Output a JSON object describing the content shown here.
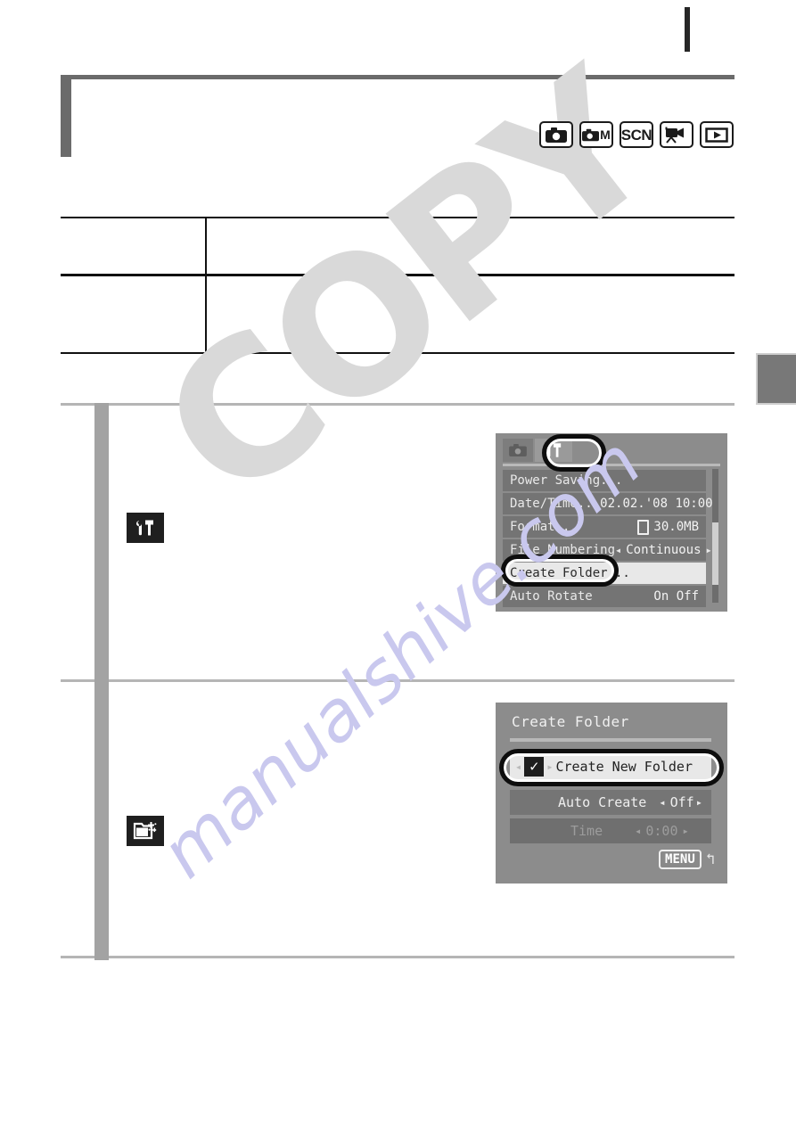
{
  "page": {
    "header": {
      "title": ""
    },
    "edge_tab_label": ""
  },
  "mode_icons": [
    {
      "name": "still-image-mode",
      "glyph": "camera"
    },
    {
      "name": "manual-mode",
      "glyph": "camera-m",
      "letter": "M"
    },
    {
      "name": "scene-mode",
      "glyph": "SCN"
    },
    {
      "name": "movie-mode",
      "glyph": "movie-camera"
    },
    {
      "name": "playback-mode",
      "glyph": "play"
    }
  ],
  "table": {
    "rows": [
      {
        "left": "",
        "right": ""
      },
      {
        "left": "",
        "right": ""
      }
    ]
  },
  "steps": [
    {
      "icon": "settings-tools-icon",
      "body": ""
    },
    {
      "icon": "create-folder-icon",
      "body": ""
    }
  ],
  "lcd_settings_menu": {
    "tabs": [
      {
        "name": "shooting-tab",
        "glyph": "camera"
      },
      {
        "name": "settings-tab",
        "glyph": "tools",
        "selected": true
      }
    ],
    "items": [
      {
        "label": "Power Saving...",
        "value": "",
        "selected": false,
        "dim": false,
        "left_arrow": false,
        "right_arrow": false,
        "doc_icon": false
      },
      {
        "label": "Date/Time...",
        "value": "02.02.'08 10:00",
        "selected": false,
        "dim": false,
        "left_arrow": false,
        "right_arrow": false,
        "doc_icon": false
      },
      {
        "label": "Format...",
        "value": "30.0MB",
        "selected": false,
        "dim": false,
        "left_arrow": false,
        "right_arrow": false,
        "doc_icon": true
      },
      {
        "label": "File Numbering",
        "value": "Continuous",
        "selected": false,
        "dim": false,
        "left_arrow": true,
        "right_arrow": true,
        "doc_icon": false
      },
      {
        "label": "Create Folder...",
        "value": "",
        "selected": true,
        "dim": false,
        "left_arrow": false,
        "right_arrow": false,
        "doc_icon": false
      },
      {
        "label": "Auto Rotate",
        "value": "On Off",
        "selected": false,
        "dim": false,
        "left_arrow": false,
        "right_arrow": false,
        "doc_icon": false
      }
    ],
    "highlighted_item_label": "Create Folder...",
    "highlighted_tab": "settings-tab"
  },
  "lcd_create_folder": {
    "title": "Create Folder",
    "rows": [
      {
        "label": "Create New Folder",
        "value": "",
        "checkbox": "✓",
        "selected": true,
        "dim": false,
        "left_arrow": true,
        "right_arrow": true
      },
      {
        "label": "Auto Create",
        "value": "Off",
        "checkbox": "",
        "selected": false,
        "dim": false,
        "left_arrow": true,
        "right_arrow": true
      },
      {
        "label": "Time",
        "value": "0:00",
        "checkbox": "",
        "selected": false,
        "dim": true,
        "left_arrow": true,
        "right_arrow": true
      }
    ],
    "menu_button": {
      "label": "MENU",
      "return_glyph": "↰"
    }
  },
  "watermarks": {
    "primary": "COPY",
    "secondary": "manualshive.com"
  },
  "colors": {
    "rule_dark": "#111111",
    "rule_grey": "#6b6b6b",
    "spine_grey": "#a3a3a3",
    "lcd_bg": "#8c8c8c",
    "lcd_row": "#747474",
    "lcd_selected": "#e8e8e8",
    "watermark_copy": "#d9d9d9",
    "watermark_site": "#c9c8ee"
  }
}
